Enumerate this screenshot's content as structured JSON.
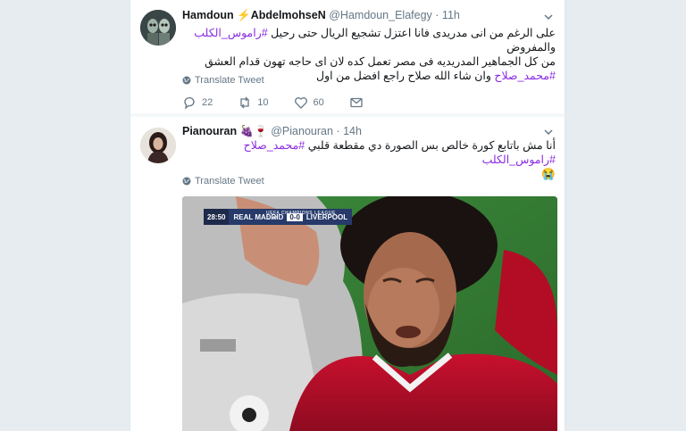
{
  "tweets": [
    {
      "display_name": "Hamdoun",
      "name_emoji": "⚡",
      "display_name_2": "AbdelmohseN",
      "handle": "@Hamdoun_Elafegy",
      "separator": "·",
      "time": "11h",
      "text_line1_a": "على الرغم من انى مدريدى فانا اعتزل تشجيع الريال حتى رحيل ",
      "text_line1_hashtag": "#راموس_الكلب",
      "text_line1_b": " والمفروض",
      "text_line2": "من كل الجماهير المدريديه فى مصر تعمل كده لان اى حاجه تهون قدام العشق",
      "text_line3_hashtag": "#محمد_صلاح",
      "text_line3_b": " وان شاء الله صلاح راجع افضل من اول",
      "translate": "Translate Tweet",
      "replies": "22",
      "retweets": "10",
      "likes": "60"
    },
    {
      "display_name": "Pianouran",
      "name_emoji": "🍇🍷",
      "handle": "@Pianouran",
      "separator": "·",
      "time": "14h",
      "text_line1": "أنا مش باتابع كورة خالص بس الصورة دي مقطعة قلبي ",
      "text_hashtag_1": "#محمد_صلاح",
      "text_hashtag_2": "#راموس_الكلب",
      "text_emoji": "😭",
      "translate": "Translate Tweet",
      "media": {
        "competition": "UEFA CHAMPIONS LEAGUE FINAL",
        "clock": "28:50",
        "home": "REAL MADRID",
        "score": "0-0",
        "away": "LIVERPOOL"
      }
    }
  ],
  "colors": {
    "hashtag": "#8a2be2",
    "muted": "#657786",
    "background": "#e6ecf0"
  }
}
